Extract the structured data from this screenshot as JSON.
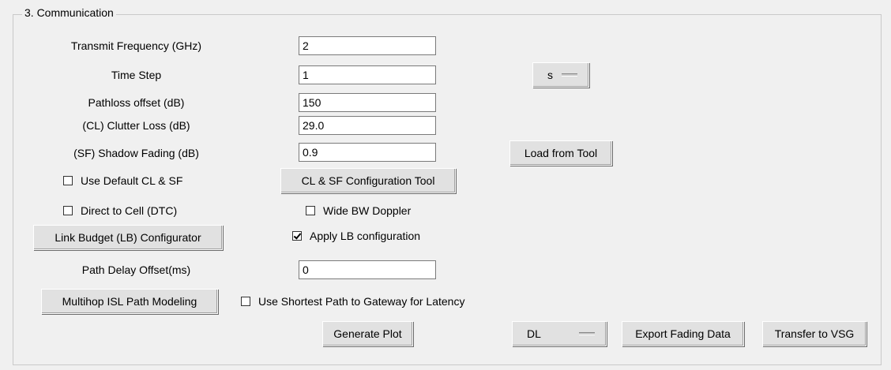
{
  "section": {
    "title": "3. Communication"
  },
  "fields": {
    "transmit_frequency": {
      "label": "Transmit Frequency (GHz)",
      "value": "2"
    },
    "time_step": {
      "label": "Time Step",
      "value": "1",
      "unit": "s"
    },
    "pathloss_offset": {
      "label": "Pathloss offset (dB)",
      "value": "150"
    },
    "clutter_loss": {
      "label": "(CL) Clutter Loss (dB)",
      "value": "29.0"
    },
    "shadow_fading": {
      "label": "(SF) Shadow Fading (dB)",
      "value": "0.9"
    },
    "path_delay_offset": {
      "label": "Path Delay Offset(ms)",
      "value": "0"
    }
  },
  "checkboxes": {
    "use_default_cl_sf": {
      "label": "Use Default CL & SF",
      "checked": false
    },
    "direct_to_cell": {
      "label": "Direct to Cell (DTC)",
      "checked": false
    },
    "wide_bw_doppler": {
      "label": "Wide BW Doppler",
      "checked": false
    },
    "apply_lb_config": {
      "label": "Apply LB configuration",
      "checked": true
    },
    "shortest_path": {
      "label": "Use Shortest Path to Gateway for Latency",
      "checked": false
    }
  },
  "buttons": {
    "load_from_tool": "Load from Tool",
    "cl_sf_config_tool": "CL & SF Configuration Tool",
    "link_budget_configurator": "Link Budget (LB) Configurator",
    "multihop_isl": "Multihop ISL Path Modeling",
    "generate_plot": "Generate Plot",
    "direction": "DL",
    "export_fading": "Export Fading Data",
    "transfer_vsg": "Transfer to VSG"
  }
}
